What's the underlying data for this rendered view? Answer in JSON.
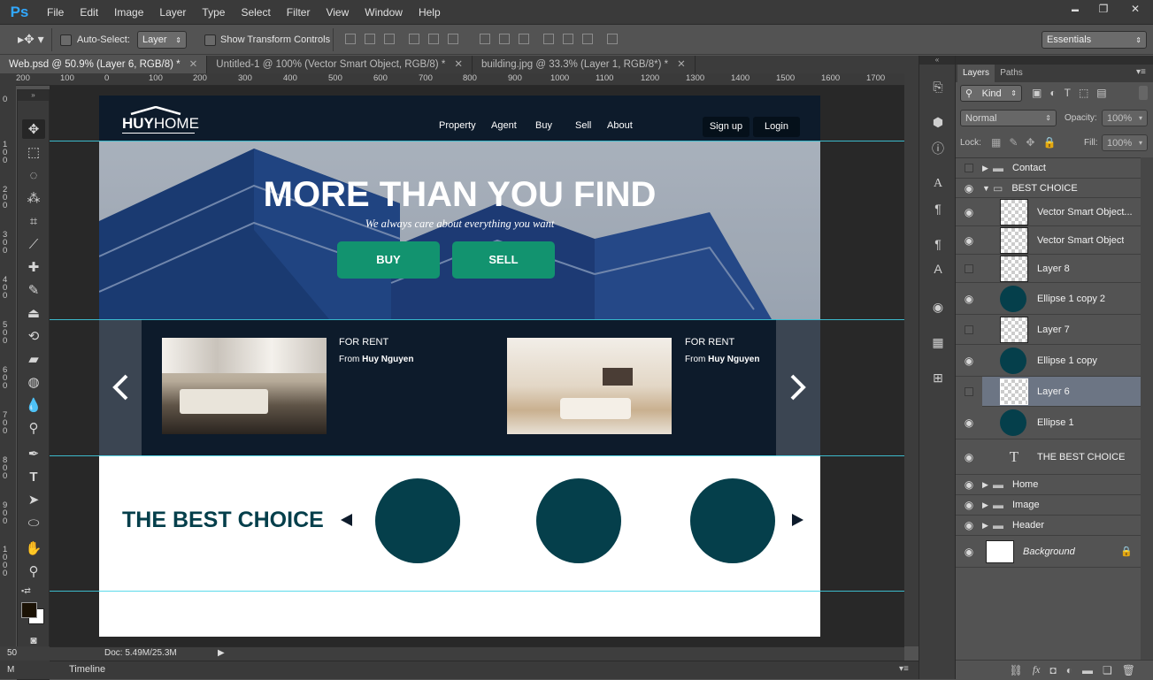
{
  "app": {
    "logo": "Ps"
  },
  "menu": [
    "File",
    "Edit",
    "Image",
    "Layer",
    "Type",
    "Select",
    "Filter",
    "View",
    "Window",
    "Help"
  ],
  "window_controls": {
    "minimize": "▬",
    "restore": "❐",
    "close": "✕"
  },
  "options_bar": {
    "auto_select_label": "Auto-Select:",
    "auto_select_value": "Layer",
    "show_transform_label": "Show Transform Controls",
    "workspace": "Essentials"
  },
  "tabs": [
    {
      "label": "Web.psd @ 50.9% (Layer 6, RGB/8) *"
    },
    {
      "label": "Untitled-1 @ 100% (Vector Smart Object, RGB/8) *"
    },
    {
      "label": "building.jpg @ 33.3% (Layer 1, RGB/8*) *"
    }
  ],
  "ruler": {
    "h": [
      "200",
      "100",
      "0",
      "100",
      "200",
      "300",
      "400",
      "500",
      "600",
      "700",
      "800",
      "900",
      "1000",
      "1100",
      "1200",
      "1300",
      "1400",
      "1500",
      "1600",
      "1700"
    ],
    "v": [
      "0",
      "1 0 0",
      "2 0 0",
      "3 0 0",
      "4 0 0",
      "5 0 0",
      "6 0 0",
      "7 0 0",
      "8 0 0",
      "9 0 0",
      "1 0 0 0"
    ]
  },
  "status": {
    "zoom": "50",
    "doc": "Doc: 5.49M/25.3M",
    "timeline": "Timeline",
    "mini_label": "M"
  },
  "site": {
    "logo_a": "HUY",
    "logo_b": "HOME",
    "nav": [
      "Property",
      "Agent",
      "Buy",
      "Sell",
      "About"
    ],
    "signup": "Sign up",
    "login": "Login",
    "hero_title": "MORE THAN YOU FIND",
    "hero_sub": "We always care about everything you want",
    "buy": "BUY",
    "sell": "SELL",
    "listings": [
      {
        "tag": "FOR RENT",
        "from": "From",
        "owner": "Huy Nguyen"
      },
      {
        "tag": "FOR RENT",
        "from": "From",
        "owner": "Huy Nguyen"
      }
    ],
    "best_title": "THE BEST CHOICE",
    "accent": "#12936f",
    "navy": "#0d1b2b",
    "teal": "#053f4b"
  },
  "layers_panel": {
    "tabs": [
      "Layers",
      "Paths"
    ],
    "kind": "Kind",
    "blend": "Normal",
    "opacity_label": "Opacity:",
    "opacity": "100%",
    "lock_label": "Lock:",
    "fill_label": "Fill:",
    "fill": "100%",
    "rows": [
      {
        "name": "Contact",
        "type": "group",
        "visible": false
      },
      {
        "name": "BEST CHOICE",
        "type": "group-open",
        "visible": true
      },
      {
        "name": "Vector Smart Object...",
        "type": "smart",
        "visible": true
      },
      {
        "name": "Vector Smart Object",
        "type": "smart",
        "visible": true
      },
      {
        "name": "Layer 8",
        "type": "layer",
        "visible": false
      },
      {
        "name": "Ellipse 1 copy 2",
        "type": "ellipse",
        "visible": true
      },
      {
        "name": "Layer 7",
        "type": "layer",
        "visible": false
      },
      {
        "name": "Ellipse 1 copy",
        "type": "ellipse",
        "visible": true
      },
      {
        "name": "Layer 6",
        "type": "layer",
        "visible": false,
        "selected": true
      },
      {
        "name": "Ellipse 1",
        "type": "ellipse",
        "visible": true
      },
      {
        "name": "THE BEST CHOICE",
        "type": "text",
        "visible": true
      },
      {
        "name": "Home",
        "type": "group",
        "visible": true
      },
      {
        "name": "Image",
        "type": "group",
        "visible": true
      },
      {
        "name": "Header",
        "type": "group",
        "visible": true
      },
      {
        "name": "Background",
        "type": "background",
        "visible": true
      }
    ]
  }
}
